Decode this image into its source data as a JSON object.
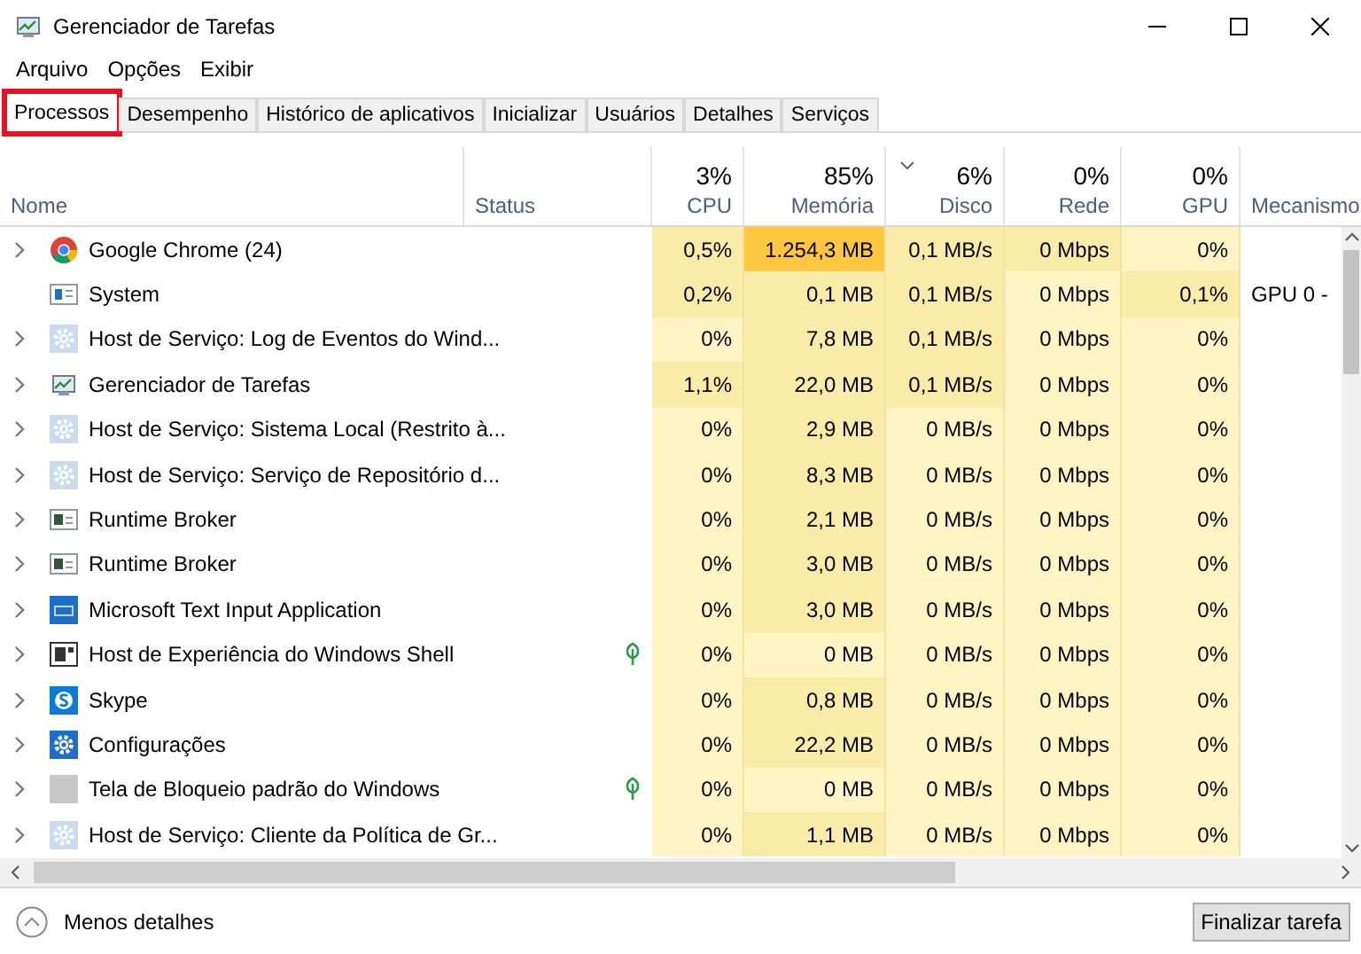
{
  "window": {
    "title": "Gerenciador de Tarefas"
  },
  "menu": [
    "Arquivo",
    "Opções",
    "Exibir"
  ],
  "tabs": [
    {
      "label": "Processos",
      "selected": true,
      "highlighted": true
    },
    {
      "label": "Desempenho",
      "selected": false,
      "highlighted": false
    },
    {
      "label": "Histórico de aplicativos",
      "selected": false,
      "highlighted": false
    },
    {
      "label": "Inicializar",
      "selected": false,
      "highlighted": false
    },
    {
      "label": "Usuários",
      "selected": false,
      "highlighted": false
    },
    {
      "label": "Detalhes",
      "selected": false,
      "highlighted": false
    },
    {
      "label": "Serviços",
      "selected": false,
      "highlighted": false
    }
  ],
  "columns": [
    {
      "label": "Nome",
      "sorted": false
    },
    {
      "label": "Status",
      "sorted": false
    },
    {
      "label": "CPU",
      "usage": "3%",
      "sorted": false
    },
    {
      "label": "Memória",
      "usage": "85%",
      "sorted": false
    },
    {
      "label": "Disco",
      "usage": "6%",
      "sorted": true
    },
    {
      "label": "Rede",
      "usage": "0%",
      "sorted": false
    },
    {
      "label": "GPU",
      "usage": "0%",
      "sorted": false
    },
    {
      "label": "Mecanismo",
      "sorted": false
    }
  ],
  "rows": [
    {
      "name": "Google Chrome (24)",
      "kind": "chrome",
      "expandable": true,
      "suspended": false,
      "cells": [
        {
          "text": "0,5%",
          "color": "#f9eca8"
        },
        {
          "text": "1.254,3 MB",
          "color": "#ffc640"
        },
        {
          "text": "0,1 MB/s",
          "color": "#f9eca8"
        },
        {
          "text": "0 Mbps",
          "color": "#f9eca8"
        },
        {
          "text": "0%",
          "color": "#fff4c4"
        }
      ]
    },
    {
      "name": "System",
      "kind": "system",
      "expandable": false,
      "suspended": false,
      "cells": [
        {
          "text": "0,2%",
          "color": "#f9eca8"
        },
        {
          "text": "0,1 MB",
          "color": "#f9eca8"
        },
        {
          "text": "0,1 MB/s",
          "color": "#f9eca8"
        },
        {
          "text": "0 Mbps",
          "color": "#fff4c4"
        },
        {
          "text": "0,1%",
          "color": "#f9eca8"
        }
      ],
      "engine": "GPU 0 -"
    },
    {
      "name": "Host de Serviço: Log de Eventos do Wind...",
      "kind": "gear",
      "expandable": true,
      "suspended": false,
      "cells": [
        {
          "text": "0%",
          "color": "#fff4c4"
        },
        {
          "text": "7,8 MB",
          "color": "#f9eca8"
        },
        {
          "text": "0,1 MB/s",
          "color": "#f9eca8"
        },
        {
          "text": "0 Mbps",
          "color": "#fff4c4"
        },
        {
          "text": "0%",
          "color": "#fff4c4"
        }
      ]
    },
    {
      "name": "Gerenciador de Tarefas",
      "kind": "taskmgr",
      "expandable": true,
      "suspended": false,
      "cells": [
        {
          "text": "1,1%",
          "color": "#f9eca8"
        },
        {
          "text": "22,0 MB",
          "color": "#f9eca8"
        },
        {
          "text": "0,1 MB/s",
          "color": "#f9eca8"
        },
        {
          "text": "0 Mbps",
          "color": "#fff4c4"
        },
        {
          "text": "0%",
          "color": "#fff4c4"
        }
      ]
    },
    {
      "name": "Host de Serviço: Sistema Local (Restrito à...",
      "kind": "gear",
      "expandable": true,
      "suspended": false,
      "cells": [
        {
          "text": "0%",
          "color": "#fff4c4"
        },
        {
          "text": "2,9 MB",
          "color": "#f9eca8"
        },
        {
          "text": "0 MB/s",
          "color": "#fff4c4"
        },
        {
          "text": "0 Mbps",
          "color": "#fff4c4"
        },
        {
          "text": "0%",
          "color": "#fff4c4"
        }
      ]
    },
    {
      "name": "Host de Serviço: Serviço de Repositório d...",
      "kind": "gear",
      "expandable": true,
      "suspended": false,
      "cells": [
        {
          "text": "0%",
          "color": "#fff4c4"
        },
        {
          "text": "8,3 MB",
          "color": "#f9eca8"
        },
        {
          "text": "0 MB/s",
          "color": "#fff4c4"
        },
        {
          "text": "0 Mbps",
          "color": "#fff4c4"
        },
        {
          "text": "0%",
          "color": "#fff4c4"
        }
      ]
    },
    {
      "name": "Runtime Broker",
      "kind": "window",
      "expandable": true,
      "suspended": false,
      "cells": [
        {
          "text": "0%",
          "color": "#fff4c4"
        },
        {
          "text": "2,1 MB",
          "color": "#f9eca8"
        },
        {
          "text": "0 MB/s",
          "color": "#fff4c4"
        },
        {
          "text": "0 Mbps",
          "color": "#fff4c4"
        },
        {
          "text": "0%",
          "color": "#fff4c4"
        }
      ]
    },
    {
      "name": "Runtime Broker",
      "kind": "window",
      "expandable": true,
      "suspended": false,
      "cells": [
        {
          "text": "0%",
          "color": "#fff4c4"
        },
        {
          "text": "3,0 MB",
          "color": "#f9eca8"
        },
        {
          "text": "0 MB/s",
          "color": "#fff4c4"
        },
        {
          "text": "0 Mbps",
          "color": "#fff4c4"
        },
        {
          "text": "0%",
          "color": "#fff4c4"
        }
      ]
    },
    {
      "name": "Microsoft Text Input Application",
      "kind": "keyboard",
      "expandable": true,
      "suspended": false,
      "cells": [
        {
          "text": "0%",
          "color": "#fff4c4"
        },
        {
          "text": "3,0 MB",
          "color": "#f9eca8"
        },
        {
          "text": "0 MB/s",
          "color": "#fff4c4"
        },
        {
          "text": "0 Mbps",
          "color": "#fff4c4"
        },
        {
          "text": "0%",
          "color": "#fff4c4"
        }
      ]
    },
    {
      "name": "Host de Experiência do Windows Shell",
      "kind": "shell",
      "expandable": true,
      "suspended": true,
      "cells": [
        {
          "text": "0%",
          "color": "#fff4c4"
        },
        {
          "text": "0 MB",
          "color": "#fff4c4"
        },
        {
          "text": "0 MB/s",
          "color": "#fff4c4"
        },
        {
          "text": "0 Mbps",
          "color": "#fff4c4"
        },
        {
          "text": "0%",
          "color": "#fff4c4"
        }
      ]
    },
    {
      "name": "Skype",
      "kind": "skype",
      "expandable": true,
      "suspended": false,
      "cells": [
        {
          "text": "0%",
          "color": "#fff4c4"
        },
        {
          "text": "0,8 MB",
          "color": "#f9eca8"
        },
        {
          "text": "0 MB/s",
          "color": "#fff4c4"
        },
        {
          "text": "0 Mbps",
          "color": "#fff4c4"
        },
        {
          "text": "0%",
          "color": "#fff4c4"
        }
      ]
    },
    {
      "name": "Configurações",
      "kind": "settings",
      "expandable": true,
      "suspended": false,
      "cells": [
        {
          "text": "0%",
          "color": "#fff4c4"
        },
        {
          "text": "22,2 MB",
          "color": "#f9eca8"
        },
        {
          "text": "0 MB/s",
          "color": "#fff4c4"
        },
        {
          "text": "0 Mbps",
          "color": "#fff4c4"
        },
        {
          "text": "0%",
          "color": "#fff4c4"
        }
      ]
    },
    {
      "name": "Tela de Bloqueio padrão do Windows",
      "kind": "blank",
      "expandable": true,
      "suspended": true,
      "cells": [
        {
          "text": "0%",
          "color": "#fff4c4"
        },
        {
          "text": "0 MB",
          "color": "#fff4c4"
        },
        {
          "text": "0 MB/s",
          "color": "#fff4c4"
        },
        {
          "text": "0 Mbps",
          "color": "#fff4c4"
        },
        {
          "text": "0%",
          "color": "#fff4c4"
        }
      ]
    },
    {
      "name": "Host de Serviço: Cliente da Política de Gr...",
      "kind": "gear",
      "expandable": true,
      "suspended": false,
      "cells": [
        {
          "text": "0%",
          "color": "#fff4c4"
        },
        {
          "text": "1,1 MB",
          "color": "#f9eca8"
        },
        {
          "text": "0 MB/s",
          "color": "#fff4c4"
        },
        {
          "text": "0 Mbps",
          "color": "#fff4c4"
        },
        {
          "text": "0%",
          "color": "#fff4c4"
        }
      ]
    }
  ],
  "footer": {
    "toggle": "Menos detalhes",
    "button": "Finalizar tarefa"
  }
}
